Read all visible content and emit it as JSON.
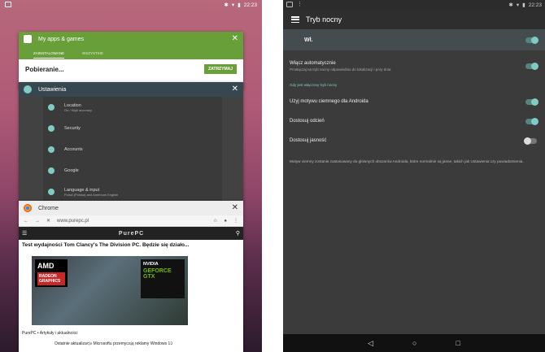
{
  "left": {
    "status": {
      "time": "22:23"
    },
    "cards": {
      "playstore": {
        "title": "My apps & games",
        "tabs": [
          "ZAINSTALOWANE",
          "WSZYSTKIE"
        ],
        "status_label": "Pobieranie...",
        "button": "ZATRZYMAJ"
      },
      "settings": {
        "title": "Ustawienia",
        "items": [
          {
            "label": "Location",
            "sub": "On / High accuracy"
          },
          {
            "label": "Security",
            "sub": ""
          },
          {
            "label": "Accounts",
            "sub": ""
          },
          {
            "label": "Google",
            "sub": ""
          },
          {
            "label": "Language & input",
            "sub": "Polski (Polska) and American English"
          }
        ]
      },
      "chrome": {
        "title": "Chrome",
        "url": "www.purepc.pl",
        "site_logo": "PurePC",
        "headline": "Test wydajności Tom Clancy's The Division PC. Będzie się działo...",
        "amd": {
          "brand": "AMD",
          "product": "RADEON GRAPHICS"
        },
        "nvidia": {
          "brand": "NVIDIA",
          "product": "GEFORCE GTX"
        },
        "category": "PurePC • Artykuły i aktualności",
        "news": "Ostatnie aktualizacje Microsoftu przemycają reklamy Windows 10"
      }
    },
    "nav": {
      "back": "◁",
      "home": "○",
      "recents": "□"
    }
  },
  "right": {
    "status": {
      "time": "22:23"
    },
    "title": "Tryb nocny",
    "master": {
      "label": "Wł.",
      "on": true
    },
    "rows": [
      {
        "label": "Włącz automatycznie",
        "sub": "Przełączaj na tryb nocny odpowiednio do lokalizacji i pory dnia",
        "on": true
      }
    ],
    "section": "Gdy jest włączony tryb nocny",
    "options": [
      {
        "label": "Użyj motywu ciemnego dla Androida",
        "on": true
      },
      {
        "label": "Dostosuj odcień",
        "on": true
      },
      {
        "label": "Dostosuj jasność",
        "on": false
      }
    ],
    "note": "Motyw ciemny zostanie zastosowany do głównych obszarów Androida, które normalnie są jasne, takich jak Ustawienia czy powiadomienia.",
    "nav": {
      "back": "◁",
      "home": "○",
      "recents": "□"
    }
  },
  "colors": {
    "accent": "#80cbc4",
    "play_green": "#689f38",
    "dark": "#3b3b3b"
  }
}
